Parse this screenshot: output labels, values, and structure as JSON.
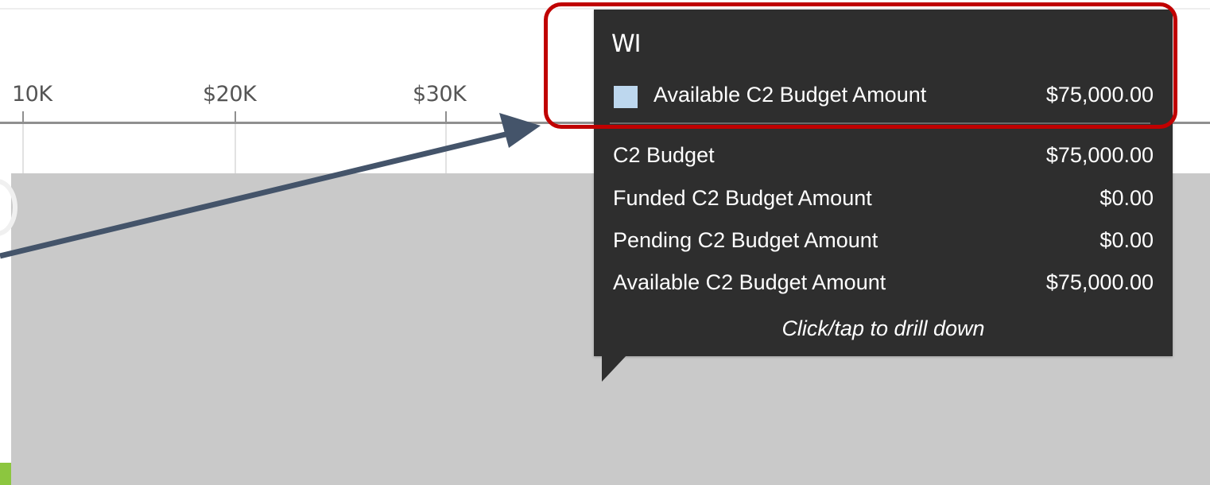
{
  "axis": {
    "ticks": [
      "10K",
      "$20K",
      "$30K"
    ]
  },
  "tooltip": {
    "title": "WI",
    "highlighted_series": {
      "label": "Available C2 Budget Amount",
      "value": "$75,000.00",
      "swatch_color": "#bdd7ee"
    },
    "rows": [
      {
        "label": "C2 Budget",
        "value": "$75,000.00"
      },
      {
        "label": "Funded C2 Budget Amount",
        "value": "$0.00"
      },
      {
        "label": "Pending C2 Budget Amount",
        "value": "$0.00"
      },
      {
        "label": "Available C2 Budget Amount",
        "value": "$75,000.00"
      }
    ],
    "footer": "Click/tap to drill down"
  },
  "colors": {
    "tooltip_bg": "#2e2e2e",
    "bar_region": "#c9c9c9",
    "highlight": "#c00000",
    "arrow": "#44546a",
    "accent_green": "#8cc63f"
  }
}
